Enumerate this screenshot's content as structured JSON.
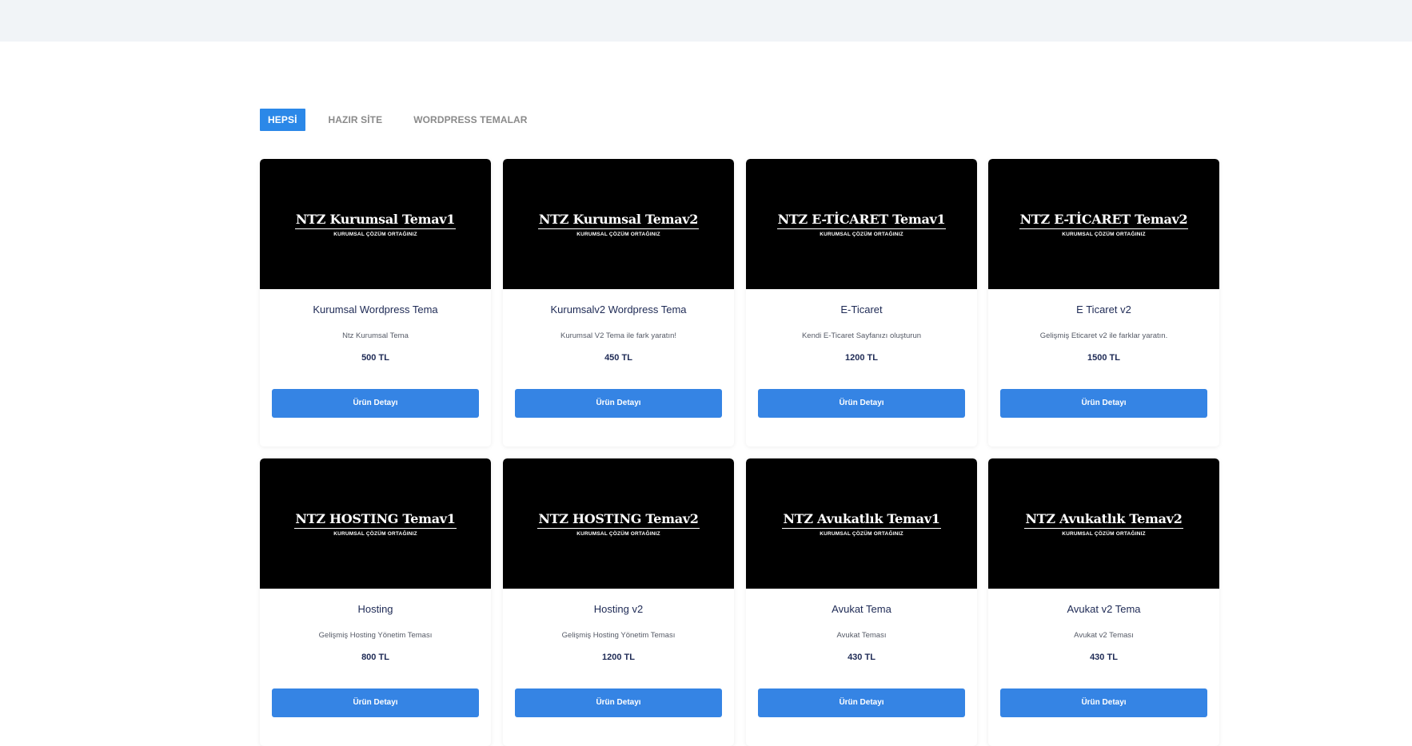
{
  "tabs": [
    {
      "label": "HEPSİ",
      "active": true
    },
    {
      "label": "HAZIR SİTE",
      "active": false
    },
    {
      "label": "WORDPRESS TEMALAR",
      "active": false
    }
  ],
  "accent_color": "#2b88e8",
  "products": [
    {
      "thumb_title": "NTZ Kurumsal Temav1",
      "thumb_sub": "KURUMSAL ÇÖZÜM ORTAĞINIZ",
      "name": "Kurumsal Wordpress Tema",
      "description": "Ntz Kurumsal Tema",
      "price": "500 TL",
      "button": "Ürün Detayı"
    },
    {
      "thumb_title": "NTZ Kurumsal Temav2",
      "thumb_sub": "KURUMSAL ÇÖZÜM ORTAĞINIZ",
      "name": "Kurumsalv2 Wordpress Tema",
      "description": "Kurumsal V2 Tema ile fark yaratın!",
      "price": "450 TL",
      "button": "Ürün Detayı"
    },
    {
      "thumb_title": "NTZ E-TİCARET Temav1",
      "thumb_sub": "KURUMSAL ÇÖZÜM ORTAĞINIZ",
      "name": "E-Ticaret",
      "description": "Kendi E-Ticaret Sayfanızı oluşturun",
      "price": "1200 TL",
      "button": "Ürün Detayı"
    },
    {
      "thumb_title": "NTZ E-TİCARET Temav2",
      "thumb_sub": "KURUMSAL ÇÖZÜM ORTAĞINIZ",
      "name": "E Ticaret v2",
      "description": "Gelişmiş Eticaret v2 ile farklar yaratın.",
      "price": "1500 TL",
      "button": "Ürün Detayı"
    },
    {
      "thumb_title": "NTZ HOSTING Temav1",
      "thumb_sub": "KURUMSAL ÇÖZÜM ORTAĞINIZ",
      "name": "Hosting",
      "description": "Gelişmiş Hosting Yönetim Teması",
      "price": "800 TL",
      "button": "Ürün Detayı"
    },
    {
      "thumb_title": "NTZ HOSTING Temav2",
      "thumb_sub": "KURUMSAL ÇÖZÜM ORTAĞINIZ",
      "name": "Hosting v2",
      "description": "Gelişmiş Hosting Yönetim Teması",
      "price": "1200 TL",
      "button": "Ürün Detayı"
    },
    {
      "thumb_title": "NTZ Avukatlık Temav1",
      "thumb_sub": "KURUMSAL ÇÖZÜM ORTAĞINIZ",
      "name": "Avukat Tema",
      "description": "Avukat Teması",
      "price": "430 TL",
      "button": "Ürün Detayı"
    },
    {
      "thumb_title": "NTZ Avukatlık Temav2",
      "thumb_sub": "KURUMSAL ÇÖZÜM ORTAĞINIZ",
      "name": "Avukat v2 Tema",
      "description": "Avukat v2 Teması",
      "price": "430 TL",
      "button": "Ürün Detayı"
    }
  ]
}
